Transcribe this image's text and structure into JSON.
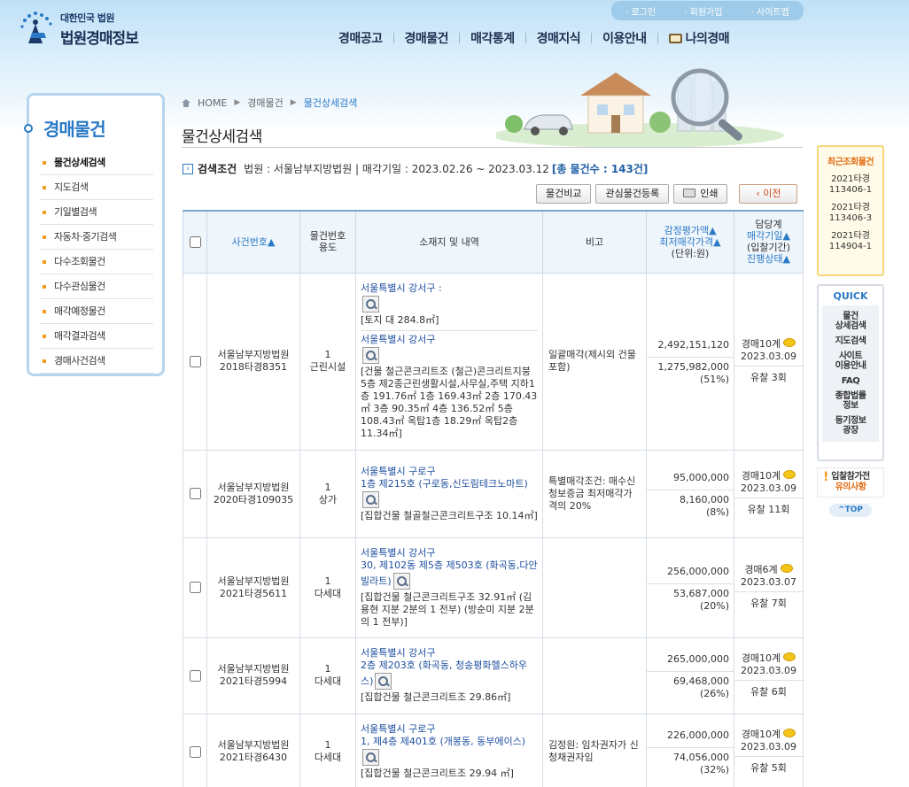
{
  "logo": {
    "sub": "대한민국 법원",
    "main": "법원경매정보"
  },
  "util": {
    "login": "· 로그인",
    "join": "· 회원가입",
    "sitemap": "· 사이트맵"
  },
  "gnb": [
    "경매공고",
    "경매물건",
    "매각통계",
    "경매지식",
    "이용안내",
    "나의경매"
  ],
  "lnb": {
    "title": "경매물건",
    "items": [
      "물건상세검색",
      "지도검색",
      "기일별검색",
      "자동차·중기검색",
      "다수조회물건",
      "다수관심물건",
      "매각예정물건",
      "매각결과검색",
      "경매사건검색"
    ]
  },
  "breadcrumb": {
    "home": "HOME",
    "level1": "경매물건",
    "current": "물건상세검색"
  },
  "page_title": "물건상세검색",
  "search_cond": {
    "label": "검색조건",
    "text": "법원 : 서울남부지방법원 | 매각기일 : 2023.02.26 ~ 2023.03.12",
    "count": "[총 물건수 : 143건]"
  },
  "buttons": {
    "compare": "물건비교",
    "interest": "관심물건등록",
    "print": "인쇄",
    "prev": "‹ 이전"
  },
  "table": {
    "headers": {
      "case": "사건번호▲",
      "item_use_1": "물건번호",
      "item_use_2": "용도",
      "address": "소재지 및 내역",
      "remark": "비고",
      "price_1": "감정평가액▲",
      "price_2": "최저매각가격▲",
      "price_3": "(단위:원)",
      "status_1": "담당계",
      "status_2": "매각기일▲",
      "status_3": "(입찰기간)",
      "status_4": "진행상태▲"
    },
    "rows": [
      {
        "court": "서울남부지방법원",
        "case_no": "2018타경8351",
        "item_no": "1",
        "use": "근린시설",
        "addr1": "서울특별시 강서구 :",
        "detail1": "[토지 대 284.8㎡]",
        "addr2": "서울특별시 강서구",
        "detail2": "[건물 철근콘크리트조 (철근)콘크리트지붕 5층 제2종근린생활시설,사무실,주택 지하1층 191.76㎡ 1층 169.43㎡ 2층 170.43㎡ 3층 90.35㎡ 4층 136.52㎡ 5층 108.43㎡ 옥탑1층 18.29㎡ 옥탑2층 11.34㎡]",
        "remark": "일괄매각(제시외 건물 포함)",
        "appraisal": "2,492,151,120",
        "min_price": "1,275,982,000",
        "min_pct": "(51%)",
        "dept": "경매10계",
        "date": "2023.03.09",
        "status": "유찰 3회"
      },
      {
        "court": "서울남부지방법원",
        "case_no": "2020타경109035",
        "item_no": "1",
        "use": "상가",
        "addr1": "서울특별시 구로구",
        "addr1b": "1층 제215호 (구로동,신도림테크노마트)",
        "detail1": "[집합건물 철골철근콘크리트구조 10.14㎡]",
        "remark": "특별매각조건: 매수신청보증금 최저매각가격의 20%",
        "appraisal": "95,000,000",
        "min_price": "8,160,000",
        "min_pct": "(8%)",
        "dept": "경매10계",
        "date": "2023.03.09",
        "status": "유찰 11회"
      },
      {
        "court": "서울남부지방법원",
        "case_no": "2021타경5611",
        "item_no": "1",
        "use": "다세대",
        "addr1": "서울특별시 강서구",
        "addr1b": "30, 제102동 제5층 제503호 (화곡동,다안빌라트)",
        "detail1": "[집합건물 철근콘크리트구조 32.91㎡ (김용현 지분 2분의 1 전부) (방순미 지분 2분의 1 전부)]",
        "remark": "",
        "appraisal": "256,000,000",
        "min_price": "53,687,000",
        "min_pct": "(20%)",
        "dept": "경매6계",
        "date": "2023.03.07",
        "status": "유찰 7회"
      },
      {
        "court": "서울남부지방법원",
        "case_no": "2021타경5994",
        "item_no": "1",
        "use": "다세대",
        "addr1": "서울특별시 강서구",
        "addr1b": "2층 제203호 (화곡동, 청송평화헬스하우스)",
        "detail1": "[집합건물 철근콘크리트조 29.86㎡]",
        "remark": "",
        "appraisal": "265,000,000",
        "min_price": "69,468,000",
        "min_pct": "(26%)",
        "dept": "경매10계",
        "date": "2023.03.09",
        "status": "유찰 6회"
      },
      {
        "court": "서울남부지방법원",
        "case_no": "2021타경6430",
        "item_no": "1",
        "use": "다세대",
        "addr1": "서울특별시 구로구",
        "addr1b": "1, 제4층 제401호 (개봉동, 동부에이스)",
        "detail1": "[집합건물 철근콘크리트조 29.94 ㎡]",
        "remark": "김정원: 임차권자가 신청채권자임",
        "appraisal": "226,000,000",
        "min_price": "74,056,000",
        "min_pct": "(32%)",
        "dept": "경매10계",
        "date": "2023.03.09",
        "status": "유찰 5회"
      }
    ]
  },
  "recent": {
    "title": "최근조회물건",
    "items": [
      [
        "2021타경",
        "113406-1"
      ],
      [
        "2021타경",
        "113406-3"
      ],
      [
        "2021타경",
        "114904-1"
      ]
    ]
  },
  "quick": {
    "title": "QUICK",
    "items": [
      [
        "물건",
        "상세검색"
      ],
      [
        "지도검색"
      ],
      [
        "사이트",
        "이용안내"
      ],
      [
        "FAQ"
      ],
      [
        "종합법률",
        "정보"
      ],
      [
        "등기정보",
        "광장"
      ]
    ]
  },
  "warn": {
    "line1": "입찰참가전",
    "line2": "유의사항"
  },
  "top": "^TOP"
}
